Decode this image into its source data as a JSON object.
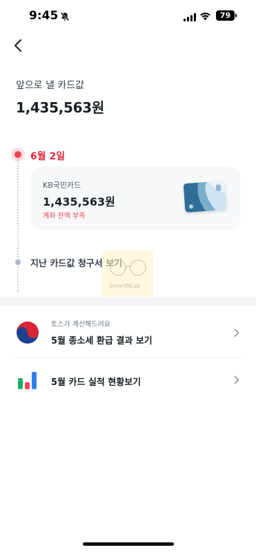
{
  "status_bar": {
    "time": "9:45",
    "battery": "79"
  },
  "header": {
    "back_icon": "chevron-left-icon"
  },
  "summary": {
    "label": "앞으로 낼 카드값",
    "amount": "1,435,563원"
  },
  "timeline": {
    "date": "6월 2일",
    "card": {
      "name": "KB국민카드",
      "amount": "1,435,563원",
      "warning": "계좌 잔액 부족",
      "image_icon": "credit-card-image"
    },
    "past_bills_label": "지난 카드값 청구서 보기"
  },
  "watermark": {
    "text": "SmartMLab"
  },
  "list": [
    {
      "icon": "korea-taegeuk-icon",
      "subtitle": "토스가 계산해드려요",
      "title": "5월 종소세 환급 결과 보기"
    },
    {
      "icon": "bar-chart-icon",
      "title": "5월 카드 실적 현황보기"
    }
  ],
  "colors": {
    "accent_red": "#f04452",
    "text_primary": "#191f28",
    "divider": "#f2f4f6"
  }
}
